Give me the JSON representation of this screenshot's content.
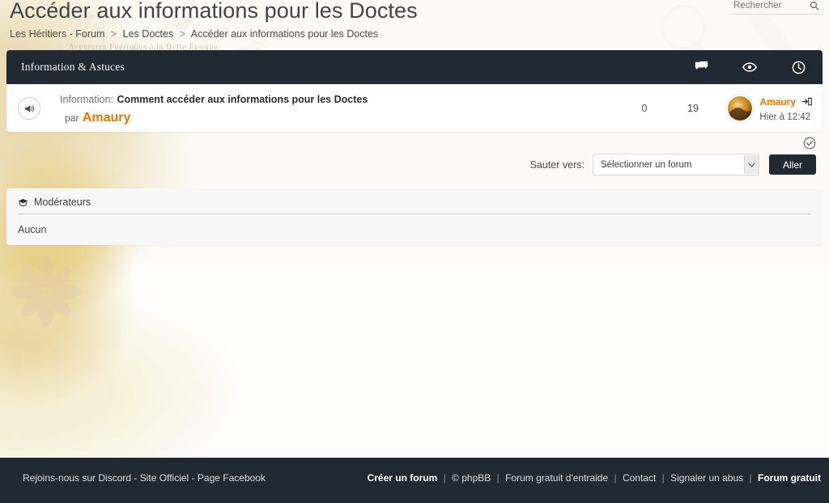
{
  "header": {
    "page_title": "Accéder aux informations pour les Doctes",
    "breadcrumb": [
      {
        "label": "Les Héritiers - Forum"
      },
      {
        "label": "Les Doctes"
      },
      {
        "label": "Accéder aux informations pour les Doctes"
      }
    ],
    "breadcrumb_separator": ">",
    "search": {
      "placeholder": "Rechercher",
      "value": "",
      "icon": "search-icon"
    },
    "watermark_tagline": "Aventures Féeriques à la Belle Époque"
  },
  "forum": {
    "title": "Information & Astuces",
    "columns": [
      {
        "icon": "replies-bubble-icon",
        "name": "replies"
      },
      {
        "icon": "views-eye-icon",
        "name": "views"
      },
      {
        "icon": "last-post-clock-icon",
        "name": "last_post"
      }
    ],
    "topics": [
      {
        "status_icon": "announcement-megaphone-icon",
        "prefix": "Information:",
        "title": "Comment accéder aux informations pour les Doctes",
        "by_label": "par",
        "author": "Amaury",
        "replies": "0",
        "views": "19",
        "last_post": {
          "avatar": "avatar-amaury",
          "author": "Amaury",
          "goto_icon": "goto-last-post-icon",
          "date": "Hier à 12:42"
        }
      }
    ]
  },
  "utilities": {
    "mark_read_icon": "mark-topics-read-icon",
    "jump": {
      "label": "Sauter vers:",
      "selected_option": "Sélectionner un forum",
      "dropdown_icon": "chevron-down-icon",
      "go_button": "Aller"
    }
  },
  "moderators": {
    "icon": "graduation-cap-icon",
    "title": "Modérateurs",
    "value": "Aucun"
  },
  "footer": {
    "left_links": [
      {
        "label": "Rejoins-nous sur Discord"
      },
      {
        "label": "Site Officiel"
      },
      {
        "label": "Page Facebook"
      }
    ],
    "left_separator": " - ",
    "right_links": [
      {
        "label": "Créer un forum",
        "bold": true
      },
      {
        "label": "© phpBB",
        "bold": false
      },
      {
        "label": "Forum gratuit d'entraide",
        "bold": false
      },
      {
        "label": "Contact",
        "bold": false
      },
      {
        "label": "Signaler un abus",
        "bold": false
      },
      {
        "label": "Forum gratuit",
        "bold": true
      }
    ],
    "right_separator": "|"
  },
  "colors": {
    "dark_bar": "#212a33",
    "accent_orange": "#e8740c",
    "page_bg": "#fdfcf8",
    "panel_bg": "#ffffff"
  }
}
